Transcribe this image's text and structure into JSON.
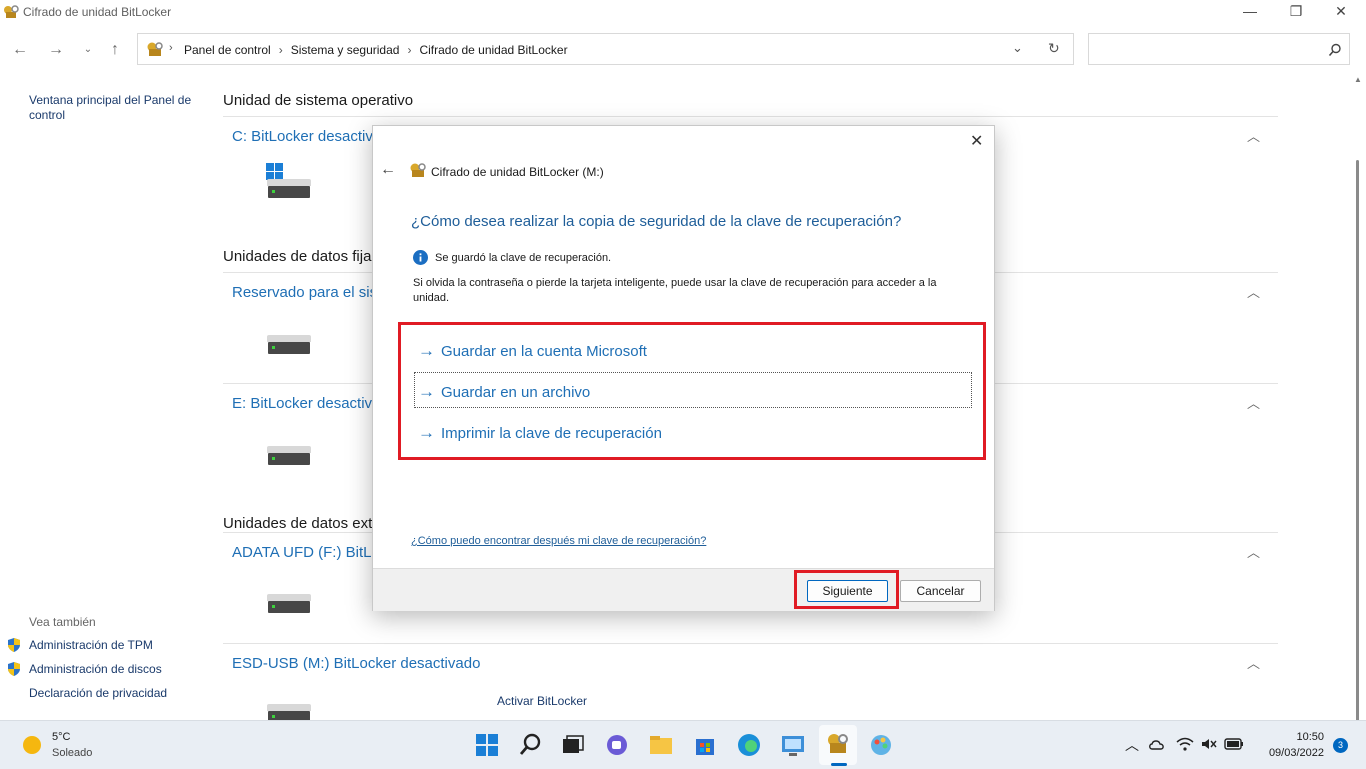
{
  "window": {
    "title": "Cifrado de unidad BitLocker",
    "controls": [
      "—",
      "❐",
      "✕"
    ]
  },
  "address": {
    "crumbs": [
      "Panel de control",
      "Sistema y seguridad",
      "Cifrado de unidad BitLocker"
    ],
    "search_placeholder": ""
  },
  "left_nav": {
    "home_link": "Ventana principal del Panel de control",
    "see_also": "Vea también",
    "links": [
      "Administración de TPM",
      "Administración de discos",
      "Declaración de privacidad"
    ]
  },
  "main": {
    "os_section": "Unidad de sistema operativo",
    "fixed_section": "Unidades de datos fija",
    "removable_section": "Unidades de datos ext",
    "drives": [
      "C: BitLocker desactiv",
      "Reservado para el sis",
      "E: BitLocker desactiva",
      "ADATA UFD (F:) BitLo",
      "ESD-USB (M:) BitLocker desactivado"
    ],
    "activate_link": "Activar BitLocker"
  },
  "dialog": {
    "header": "Cifrado de unidad BitLocker (M:)",
    "question": "¿Cómo desea realizar la copia de seguridad de la clave de recuperación?",
    "info": "Se guardó la clave de recuperación.",
    "description": "Si olvida la contraseña o pierde la tarjeta inteligente, puede usar la clave de recuperación para acceder a la unidad.",
    "options": [
      "Guardar en la cuenta Microsoft",
      "Guardar en un archivo",
      "Imprimir la clave de recuperación"
    ],
    "help_link": "¿Cómo puedo encontrar después mi clave de recuperación?",
    "next_button": "Siguiente",
    "cancel_button": "Cancelar",
    "highlight_color": "#e01b24"
  },
  "taskbar": {
    "weather_temp": "5°C",
    "weather_desc": "Soleado",
    "time": "10:50",
    "date": "09/03/2022",
    "notification_count": "3"
  }
}
